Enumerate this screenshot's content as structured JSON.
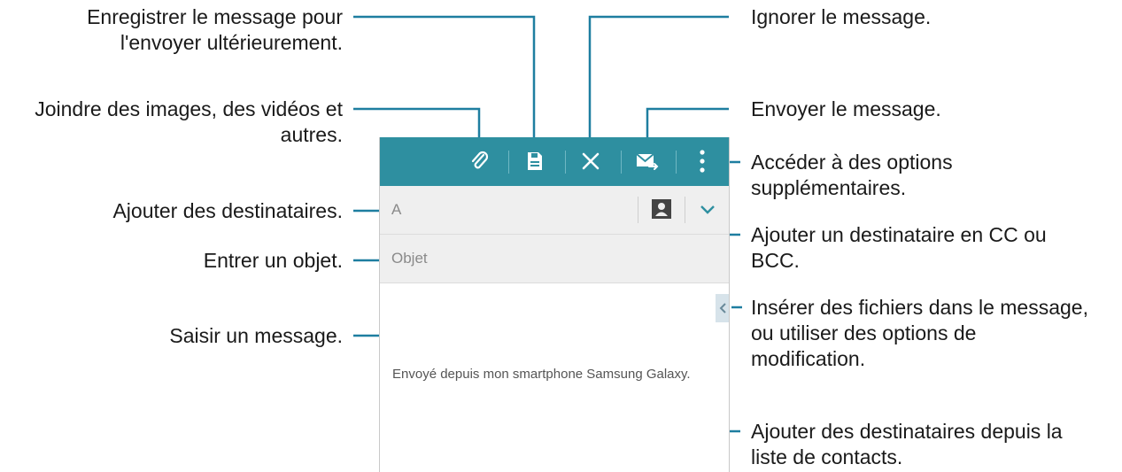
{
  "callouts": {
    "save": "Enregistrer le message pour\nl'envoyer ultérieurement.",
    "attach": "Joindre des images, des vidéos et\nautres.",
    "recipients": "Ajouter des destinataires.",
    "subject": "Entrer un objet.",
    "message": "Saisir un message.",
    "discard": "Ignorer le message.",
    "send": "Envoyer le message.",
    "more_options": "Accéder à des options\nsupplémentaires.",
    "cc_bcc": "Ajouter un destinataire en CC ou\nBCC.",
    "insert": "Insérer des fichiers dans le message,\nou utiliser des options de\nmodification.",
    "contacts": "Ajouter des destinataires depuis la\nliste de contacts."
  },
  "composer": {
    "to_label": "A",
    "subject_label": "Objet",
    "signature": "Envoyé depuis mon smartphone Samsung Galaxy."
  },
  "icons": {
    "attach": "paperclip-icon",
    "save": "save-icon",
    "discard": "close-icon",
    "send": "send-icon",
    "more": "more-vertical-icon",
    "contacts": "contact-card-icon",
    "cc_bcc": "chevron-down-icon",
    "insert": "chevron-left-icon"
  },
  "colors": {
    "action_bar": "#2e8fa0",
    "callout_line": "#1e7ea0"
  }
}
